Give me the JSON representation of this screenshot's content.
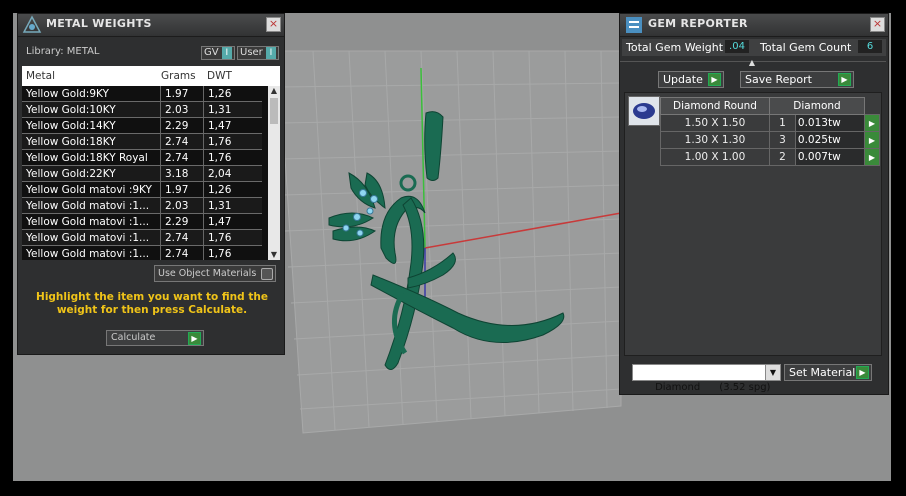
{
  "metal_weights": {
    "title": "METAL WEIGHTS",
    "library_label": "Library: METAL",
    "gv_label": "GV",
    "user_label": "User",
    "columns": [
      "Metal",
      "Grams",
      "DWT"
    ],
    "rows": [
      [
        "Yellow Gold:9KY",
        "1.97",
        "1,26"
      ],
      [
        "Yellow Gold:10KY",
        "2.03",
        "1,31"
      ],
      [
        "Yellow Gold:14KY",
        "2.29",
        "1,47"
      ],
      [
        "Yellow Gold:18KY",
        "2.74",
        "1,76"
      ],
      [
        "Yellow Gold:18KY Royal",
        "2.74",
        "1,76"
      ],
      [
        "Yellow Gold:22KY",
        "3.18",
        "2,04"
      ],
      [
        "Yellow Gold matovi :9KY",
        "1.97",
        "1,26"
      ],
      [
        "Yellow Gold matovi :1...",
        "2.03",
        "1,31"
      ],
      [
        "Yellow Gold matovi :1...",
        "2.29",
        "1,47"
      ],
      [
        "Yellow Gold matovi :1...",
        "2.74",
        "1,76"
      ],
      [
        "Yellow Gold matovi :1...",
        "2.74",
        "1,76"
      ]
    ],
    "use_object_materials": "Use Object Materials",
    "hint": "Highlight the item you want to find the weight for then press Calculate.",
    "calculate_label": "Calculate"
  },
  "gem_reporter": {
    "title": "GEM REPORTER",
    "total_weight_label": "Total Gem Weight",
    "total_weight_value": ".04",
    "total_count_label": "Total Gem Count",
    "total_count_value": "6",
    "update_label": "Update",
    "save_report_label": "Save Report",
    "col_shape": "Diamond Round",
    "col_material": "Diamond",
    "rows": [
      [
        "1.50 X 1.50",
        "1",
        "0.013tw"
      ],
      [
        "1.30 X 1.30",
        "3",
        "0.025tw"
      ],
      [
        "1.00 X 1.00",
        "2",
        "0.007tw"
      ]
    ],
    "material_select": "Diamond      (3.52 spg)",
    "set_material_label": "Set Material"
  },
  "colors": {
    "model": "#1a6b52",
    "hint_text": "#f0c419"
  }
}
